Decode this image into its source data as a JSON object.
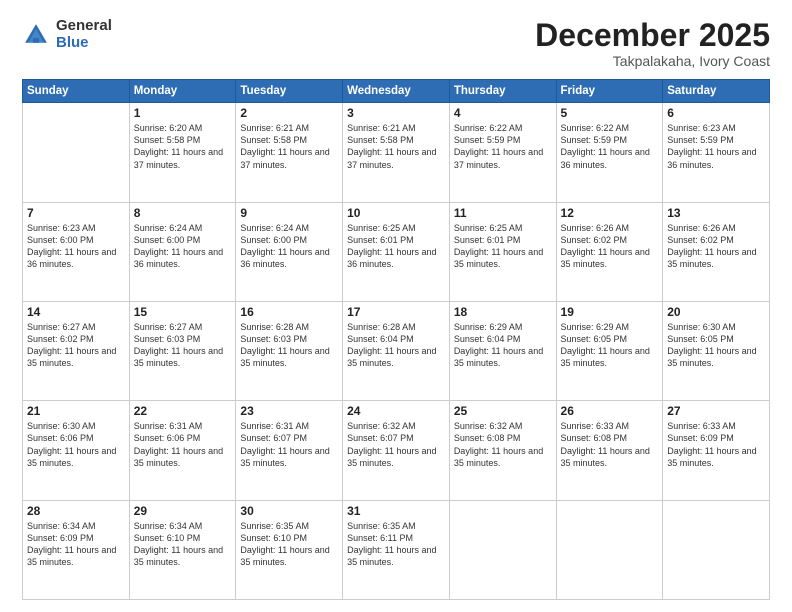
{
  "logo": {
    "general": "General",
    "blue": "Blue"
  },
  "title": {
    "month": "December 2025",
    "location": "Takpalakaha, Ivory Coast"
  },
  "weekdays": [
    "Sunday",
    "Monday",
    "Tuesday",
    "Wednesday",
    "Thursday",
    "Friday",
    "Saturday"
  ],
  "weeks": [
    [
      {
        "day": "",
        "info": ""
      },
      {
        "day": "1",
        "info": "Sunrise: 6:20 AM\nSunset: 5:58 PM\nDaylight: 11 hours and 37 minutes."
      },
      {
        "day": "2",
        "info": "Sunrise: 6:21 AM\nSunset: 5:58 PM\nDaylight: 11 hours and 37 minutes."
      },
      {
        "day": "3",
        "info": "Sunrise: 6:21 AM\nSunset: 5:58 PM\nDaylight: 11 hours and 37 minutes."
      },
      {
        "day": "4",
        "info": "Sunrise: 6:22 AM\nSunset: 5:59 PM\nDaylight: 11 hours and 37 minutes."
      },
      {
        "day": "5",
        "info": "Sunrise: 6:22 AM\nSunset: 5:59 PM\nDaylight: 11 hours and 36 minutes."
      },
      {
        "day": "6",
        "info": "Sunrise: 6:23 AM\nSunset: 5:59 PM\nDaylight: 11 hours and 36 minutes."
      }
    ],
    [
      {
        "day": "7",
        "info": "Sunrise: 6:23 AM\nSunset: 6:00 PM\nDaylight: 11 hours and 36 minutes."
      },
      {
        "day": "8",
        "info": "Sunrise: 6:24 AM\nSunset: 6:00 PM\nDaylight: 11 hours and 36 minutes."
      },
      {
        "day": "9",
        "info": "Sunrise: 6:24 AM\nSunset: 6:00 PM\nDaylight: 11 hours and 36 minutes."
      },
      {
        "day": "10",
        "info": "Sunrise: 6:25 AM\nSunset: 6:01 PM\nDaylight: 11 hours and 36 minutes."
      },
      {
        "day": "11",
        "info": "Sunrise: 6:25 AM\nSunset: 6:01 PM\nDaylight: 11 hours and 35 minutes."
      },
      {
        "day": "12",
        "info": "Sunrise: 6:26 AM\nSunset: 6:02 PM\nDaylight: 11 hours and 35 minutes."
      },
      {
        "day": "13",
        "info": "Sunrise: 6:26 AM\nSunset: 6:02 PM\nDaylight: 11 hours and 35 minutes."
      }
    ],
    [
      {
        "day": "14",
        "info": "Sunrise: 6:27 AM\nSunset: 6:02 PM\nDaylight: 11 hours and 35 minutes."
      },
      {
        "day": "15",
        "info": "Sunrise: 6:27 AM\nSunset: 6:03 PM\nDaylight: 11 hours and 35 minutes."
      },
      {
        "day": "16",
        "info": "Sunrise: 6:28 AM\nSunset: 6:03 PM\nDaylight: 11 hours and 35 minutes."
      },
      {
        "day": "17",
        "info": "Sunrise: 6:28 AM\nSunset: 6:04 PM\nDaylight: 11 hours and 35 minutes."
      },
      {
        "day": "18",
        "info": "Sunrise: 6:29 AM\nSunset: 6:04 PM\nDaylight: 11 hours and 35 minutes."
      },
      {
        "day": "19",
        "info": "Sunrise: 6:29 AM\nSunset: 6:05 PM\nDaylight: 11 hours and 35 minutes."
      },
      {
        "day": "20",
        "info": "Sunrise: 6:30 AM\nSunset: 6:05 PM\nDaylight: 11 hours and 35 minutes."
      }
    ],
    [
      {
        "day": "21",
        "info": "Sunrise: 6:30 AM\nSunset: 6:06 PM\nDaylight: 11 hours and 35 minutes."
      },
      {
        "day": "22",
        "info": "Sunrise: 6:31 AM\nSunset: 6:06 PM\nDaylight: 11 hours and 35 minutes."
      },
      {
        "day": "23",
        "info": "Sunrise: 6:31 AM\nSunset: 6:07 PM\nDaylight: 11 hours and 35 minutes."
      },
      {
        "day": "24",
        "info": "Sunrise: 6:32 AM\nSunset: 6:07 PM\nDaylight: 11 hours and 35 minutes."
      },
      {
        "day": "25",
        "info": "Sunrise: 6:32 AM\nSunset: 6:08 PM\nDaylight: 11 hours and 35 minutes."
      },
      {
        "day": "26",
        "info": "Sunrise: 6:33 AM\nSunset: 6:08 PM\nDaylight: 11 hours and 35 minutes."
      },
      {
        "day": "27",
        "info": "Sunrise: 6:33 AM\nSunset: 6:09 PM\nDaylight: 11 hours and 35 minutes."
      }
    ],
    [
      {
        "day": "28",
        "info": "Sunrise: 6:34 AM\nSunset: 6:09 PM\nDaylight: 11 hours and 35 minutes."
      },
      {
        "day": "29",
        "info": "Sunrise: 6:34 AM\nSunset: 6:10 PM\nDaylight: 11 hours and 35 minutes."
      },
      {
        "day": "30",
        "info": "Sunrise: 6:35 AM\nSunset: 6:10 PM\nDaylight: 11 hours and 35 minutes."
      },
      {
        "day": "31",
        "info": "Sunrise: 6:35 AM\nSunset: 6:11 PM\nDaylight: 11 hours and 35 minutes."
      },
      {
        "day": "",
        "info": ""
      },
      {
        "day": "",
        "info": ""
      },
      {
        "day": "",
        "info": ""
      }
    ]
  ]
}
